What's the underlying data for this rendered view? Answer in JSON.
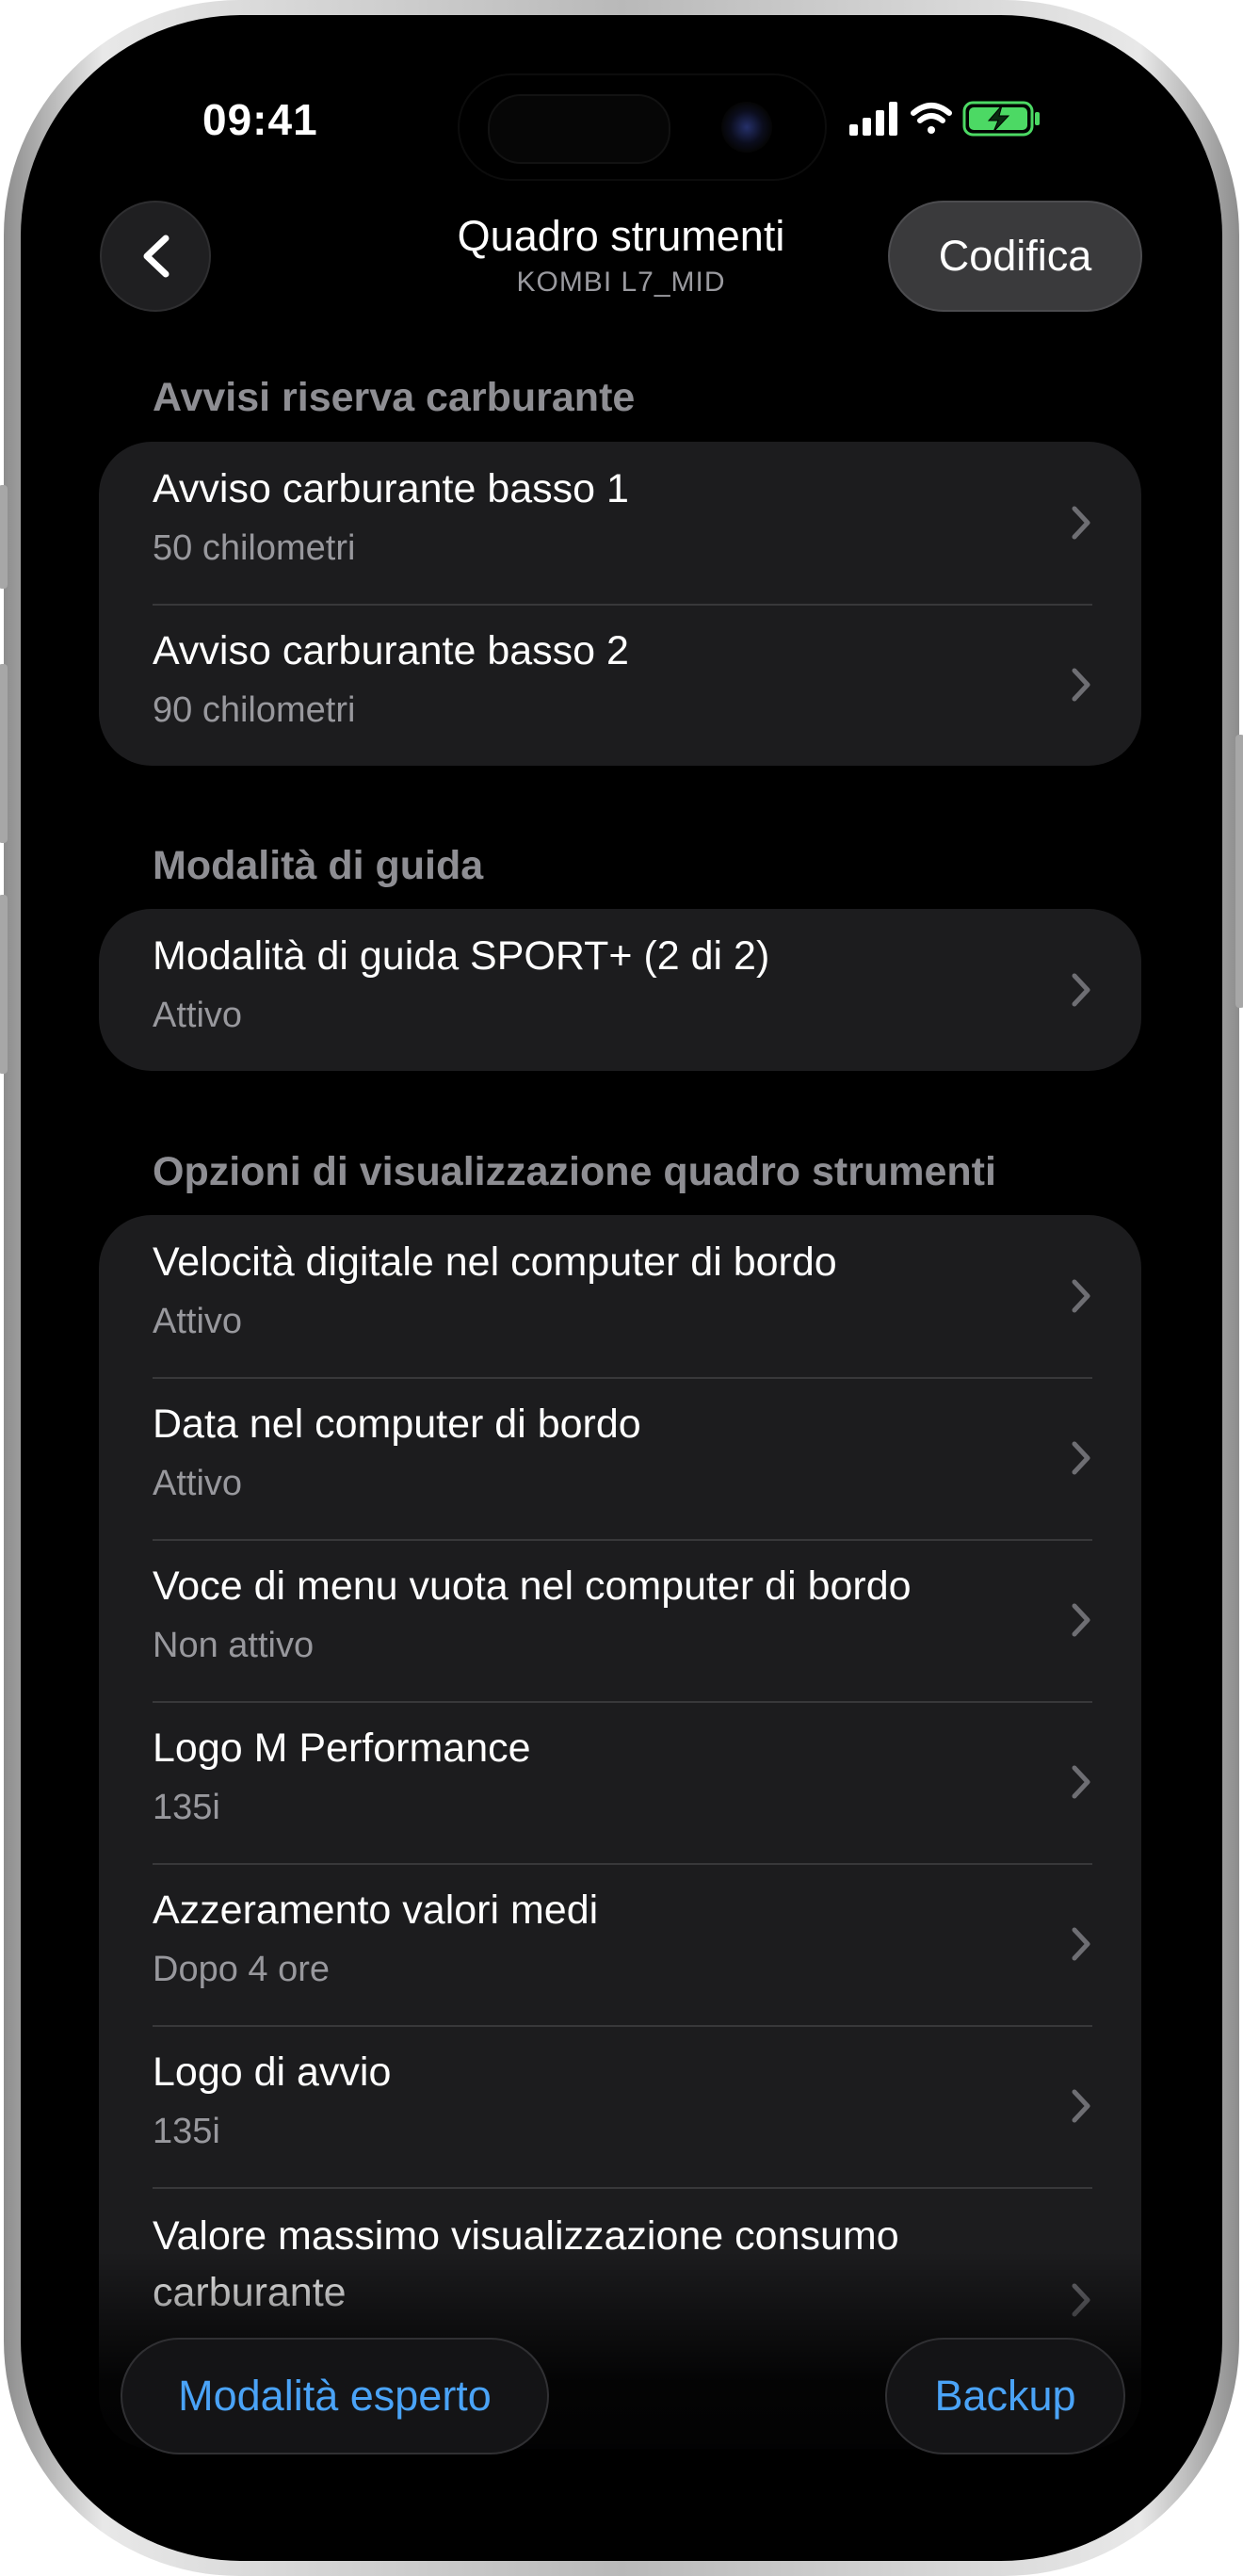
{
  "status_bar": {
    "time": "09:41"
  },
  "header": {
    "title": "Quadro strumenti",
    "subtitle": "KOMBI L7_MID",
    "edit_label": "Codifica"
  },
  "sections": [
    {
      "header": "Avvisi riserva carburante",
      "items": [
        {
          "title": "Avviso carburante basso 1",
          "value": "50 chilometri"
        },
        {
          "title": "Avviso carburante basso 2",
          "value": "90 chilometri"
        }
      ]
    },
    {
      "header": "Modalità di guida",
      "items": [
        {
          "title": "Modalità di guida SPORT+ (2 di 2)",
          "value": "Attivo"
        }
      ]
    },
    {
      "header": "Opzioni di visualizzazione quadro strumenti",
      "items": [
        {
          "title": "Velocità digitale nel computer di bordo",
          "value": "Attivo"
        },
        {
          "title": "Data nel computer di bordo",
          "value": "Attivo"
        },
        {
          "title": "Voce di menu vuota nel computer di bordo",
          "value": "Non attivo"
        },
        {
          "title": "Logo M Performance",
          "value": "135i"
        },
        {
          "title": "Azzeramento valori medi",
          "value": "Dopo 4 ore"
        },
        {
          "title": "Logo di avvio",
          "value": "135i"
        },
        {
          "title": "Valore massimo visualizzazione consumo carburante",
          "value": ""
        }
      ]
    }
  ],
  "bottom_bar": {
    "expert_mode_label": "Modalità esperto",
    "backup_label": "Backup"
  },
  "colors": {
    "background": "#000000",
    "card": "#1c1c1e",
    "secondary_text": "#98989d",
    "accent_blue": "#4aa3f7",
    "battery_green": "#4cd964"
  },
  "icons": [
    "chevron-left-icon",
    "chevron-right-icon",
    "cellular-signal-icon",
    "wifi-icon",
    "battery-charging-icon"
  ]
}
